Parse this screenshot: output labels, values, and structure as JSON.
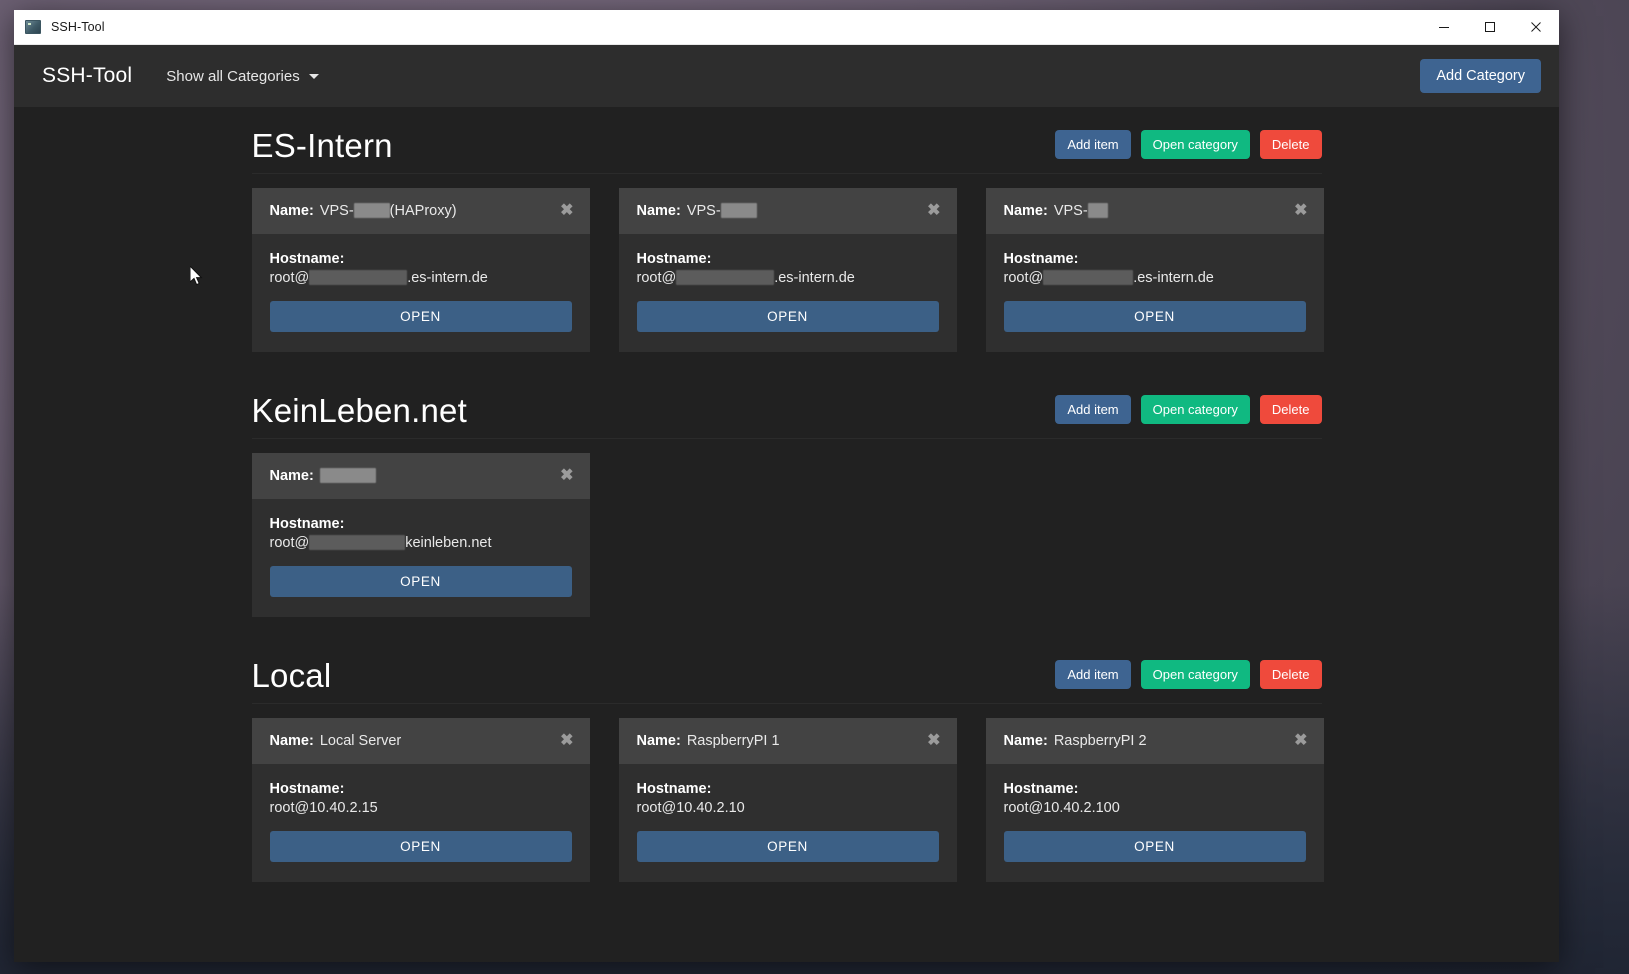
{
  "window": {
    "title": "SSH-Tool",
    "icon": "terminal-icon",
    "controls": {
      "minimize": "minimize-icon",
      "maximize": "maximize-icon",
      "close": "close-icon"
    }
  },
  "navbar": {
    "brand": "SSH-Tool",
    "category_filter": "Show all Categories",
    "add_category_label": "Add Category"
  },
  "colors": {
    "accent_blue": "#3e6491",
    "open_green": "#10b981",
    "delete_red": "#ef4a3c",
    "navbar_bg": "#2d2d2d",
    "body_bg": "#212121",
    "card_bg": "#2f2f2f",
    "card_head_bg": "#434343",
    "open_button": "#3c6086"
  },
  "labels": {
    "name": "Name:",
    "hostname": "Hostname:",
    "open": "OPEN",
    "add_item": "Add item",
    "open_category": "Open category",
    "delete": "Delete",
    "close": "✖"
  },
  "categories": [
    {
      "title": "ES-Intern",
      "items": [
        {
          "name_prefix": "VPS-",
          "name_redacted_width": 36,
          "name_suffix": " (HAProxy)",
          "host_prefix": "root@",
          "host_redacted_width": 98,
          "host_suffix": ".es-intern.de"
        },
        {
          "name_prefix": "VPS-",
          "name_redacted_width": 36,
          "name_suffix": "",
          "host_prefix": "root@",
          "host_redacted_width": 98,
          "host_suffix": ".es-intern.de"
        },
        {
          "name_prefix": "VPS-",
          "name_redacted_width": 20,
          "name_suffix": "",
          "host_prefix": "root@",
          "host_redacted_width": 90,
          "host_suffix": ".es-intern.de"
        }
      ]
    },
    {
      "title": "KeinLeben.net",
      "items": [
        {
          "name_prefix": "",
          "name_redacted_width": 56,
          "name_suffix": "",
          "host_prefix": "root@",
          "host_redacted_width": 96,
          "host_suffix": "keinleben.net"
        }
      ]
    },
    {
      "title": "Local",
      "items": [
        {
          "name_prefix": "Local Server",
          "name_redacted_width": 0,
          "name_suffix": "",
          "host_prefix": "root@10.40.2.15",
          "host_redacted_width": 0,
          "host_suffix": ""
        },
        {
          "name_prefix": "RaspberryPI 1",
          "name_redacted_width": 0,
          "name_suffix": "",
          "host_prefix": "root@10.40.2.10",
          "host_redacted_width": 0,
          "host_suffix": ""
        },
        {
          "name_prefix": "RaspberryPI 2",
          "name_redacted_width": 0,
          "name_suffix": "",
          "host_prefix": "root@10.40.2.100",
          "host_redacted_width": 0,
          "host_suffix": ""
        }
      ]
    }
  ]
}
